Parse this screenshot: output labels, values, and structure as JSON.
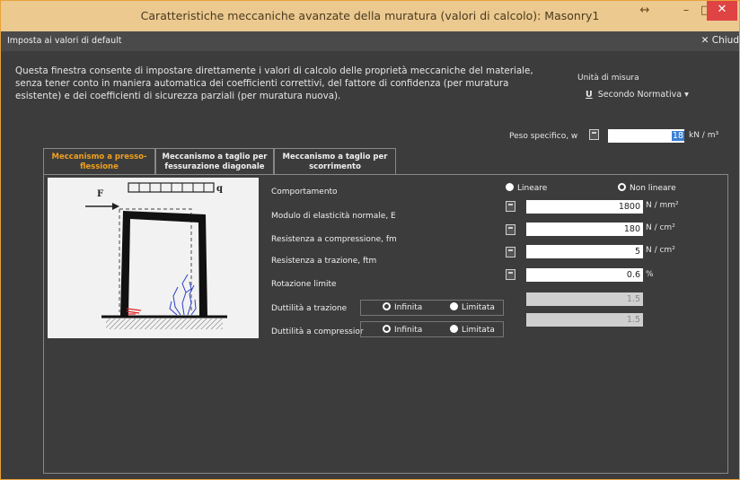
{
  "window": {
    "title": "Caratteristiche meccaniche avanzate della muratura (valori di calcolo): Masonry1",
    "btn_restore": "↔",
    "btn_minimize": "–",
    "btn_maximize": "□",
    "btn_close": "✕"
  },
  "toolbar": {
    "defaults_label": "Imposta ai valori di default",
    "close_label": "✕ Chiud"
  },
  "description": "Questa finestra consente di impostare direttamente i valori di calcolo delle proprietà meccaniche del materiale, senza tener conto in maniera automatica dei coefficienti correttivi, del fattore di confidenza (per muratura esistente) e dei coefficienti di sicurezza parziali (per muratura nuova).",
  "units": {
    "label": "Unità di misura",
    "accel": "U",
    "value": "Secondo Normativa",
    "caret": "▾"
  },
  "peso": {
    "label": "Peso specifico, w",
    "value": "18",
    "unit": "kN / m³"
  },
  "tabs": [
    {
      "label": "Meccanismo a presso-flessione",
      "active": true
    },
    {
      "label": "Meccanismo a taglio per fessurazione diagonale",
      "active": false
    },
    {
      "label": "Meccanismo a taglio per scorrimento",
      "active": false
    }
  ],
  "figure": {
    "force_label": "F",
    "load_label": "q"
  },
  "comportamento": {
    "label": "Comportamento",
    "option_linear": "Lineare",
    "option_nonlinear": "Non lineare",
    "selected": "Non lineare"
  },
  "modulo": {
    "label": "Modulo di elasticità normale, E",
    "value": "1800",
    "unit": "N / mm²"
  },
  "compressione": {
    "label": "Resistenza a compressione, fm",
    "value": "180",
    "unit": "N / cm²"
  },
  "trazione": {
    "label": "Resistenza a trazione, ftm",
    "value": "5",
    "unit": "N / cm²"
  },
  "rotazione": {
    "label": "Rotazione limite",
    "value": "0.6",
    "unit": "%"
  },
  "duttilita_trazione": {
    "label": "Duttilità a trazione",
    "option_infinite": "Infinita",
    "option_limited": "Limitata",
    "selected": "Infinita",
    "value": "1.5"
  },
  "duttilita_compressione": {
    "label": "Duttilità a compressior",
    "option_infinite": "Infinita",
    "option_limited": "Limitata",
    "selected": "Infinita",
    "value": "1.5"
  }
}
